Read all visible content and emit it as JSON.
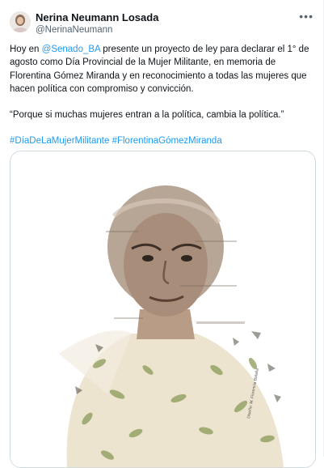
{
  "author": {
    "name": "Nerina Neumann Losada",
    "handle": "@NerinaNeumann"
  },
  "menu_icon": "more-horizontal-icon",
  "tweet": {
    "line1_prefix": "Hoy en ",
    "mention": "@Senado_BA",
    "line1_rest": "  presente un proyecto de ley para declarar el 1° de agosto como Día Provincial de la Mujer Militante, en memoria de Florentina Gómez Miranda y en reconocimiento a todas las mujeres que hacen política con compromiso y convicción.",
    "quote": "“Porque si muchas mujeres entran a la política, cambia la política.”",
    "hashtag1": "#DíaDeLaMujerMilitante",
    "hashtag2": "#FlorentinaGómezMiranda"
  },
  "media": {
    "credit": "Diseño: M. Florencia Batalla"
  },
  "colors": {
    "link": "#1d9bf0",
    "secondary_text": "#536471",
    "border": "#cfd9de"
  }
}
